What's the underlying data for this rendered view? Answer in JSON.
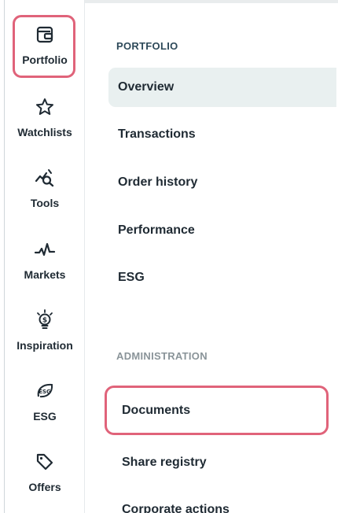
{
  "rail": {
    "items": [
      {
        "label": "Portfolio",
        "icon": "wallet-icon",
        "active": true
      },
      {
        "label": "Watchlists",
        "icon": "star-icon"
      },
      {
        "label": "Tools",
        "icon": "chart-search-icon"
      },
      {
        "label": "Markets",
        "icon": "pulse-line-icon"
      },
      {
        "label": "Inspiration",
        "icon": "lightbulb-dollar-icon"
      },
      {
        "label": "ESG",
        "icon": "esg-leaf-icon"
      },
      {
        "label": "Offers",
        "icon": "tag-icon"
      }
    ]
  },
  "menu": {
    "portfolio_title": "PORTFOLIO",
    "portfolio_items": [
      "Overview",
      "Transactions",
      "Order history",
      "Performance",
      "ESG"
    ],
    "admin_title": "ADMINISTRATION",
    "admin_items": [
      "Documents",
      "Share registry",
      "Corporate actions"
    ]
  },
  "colors": {
    "highlight": "#e0637a",
    "selected_bg": "#e9f0f0",
    "section_title": "#2e4a5a",
    "section_title_muted": "#8a9499",
    "text": "#1f2a33"
  }
}
